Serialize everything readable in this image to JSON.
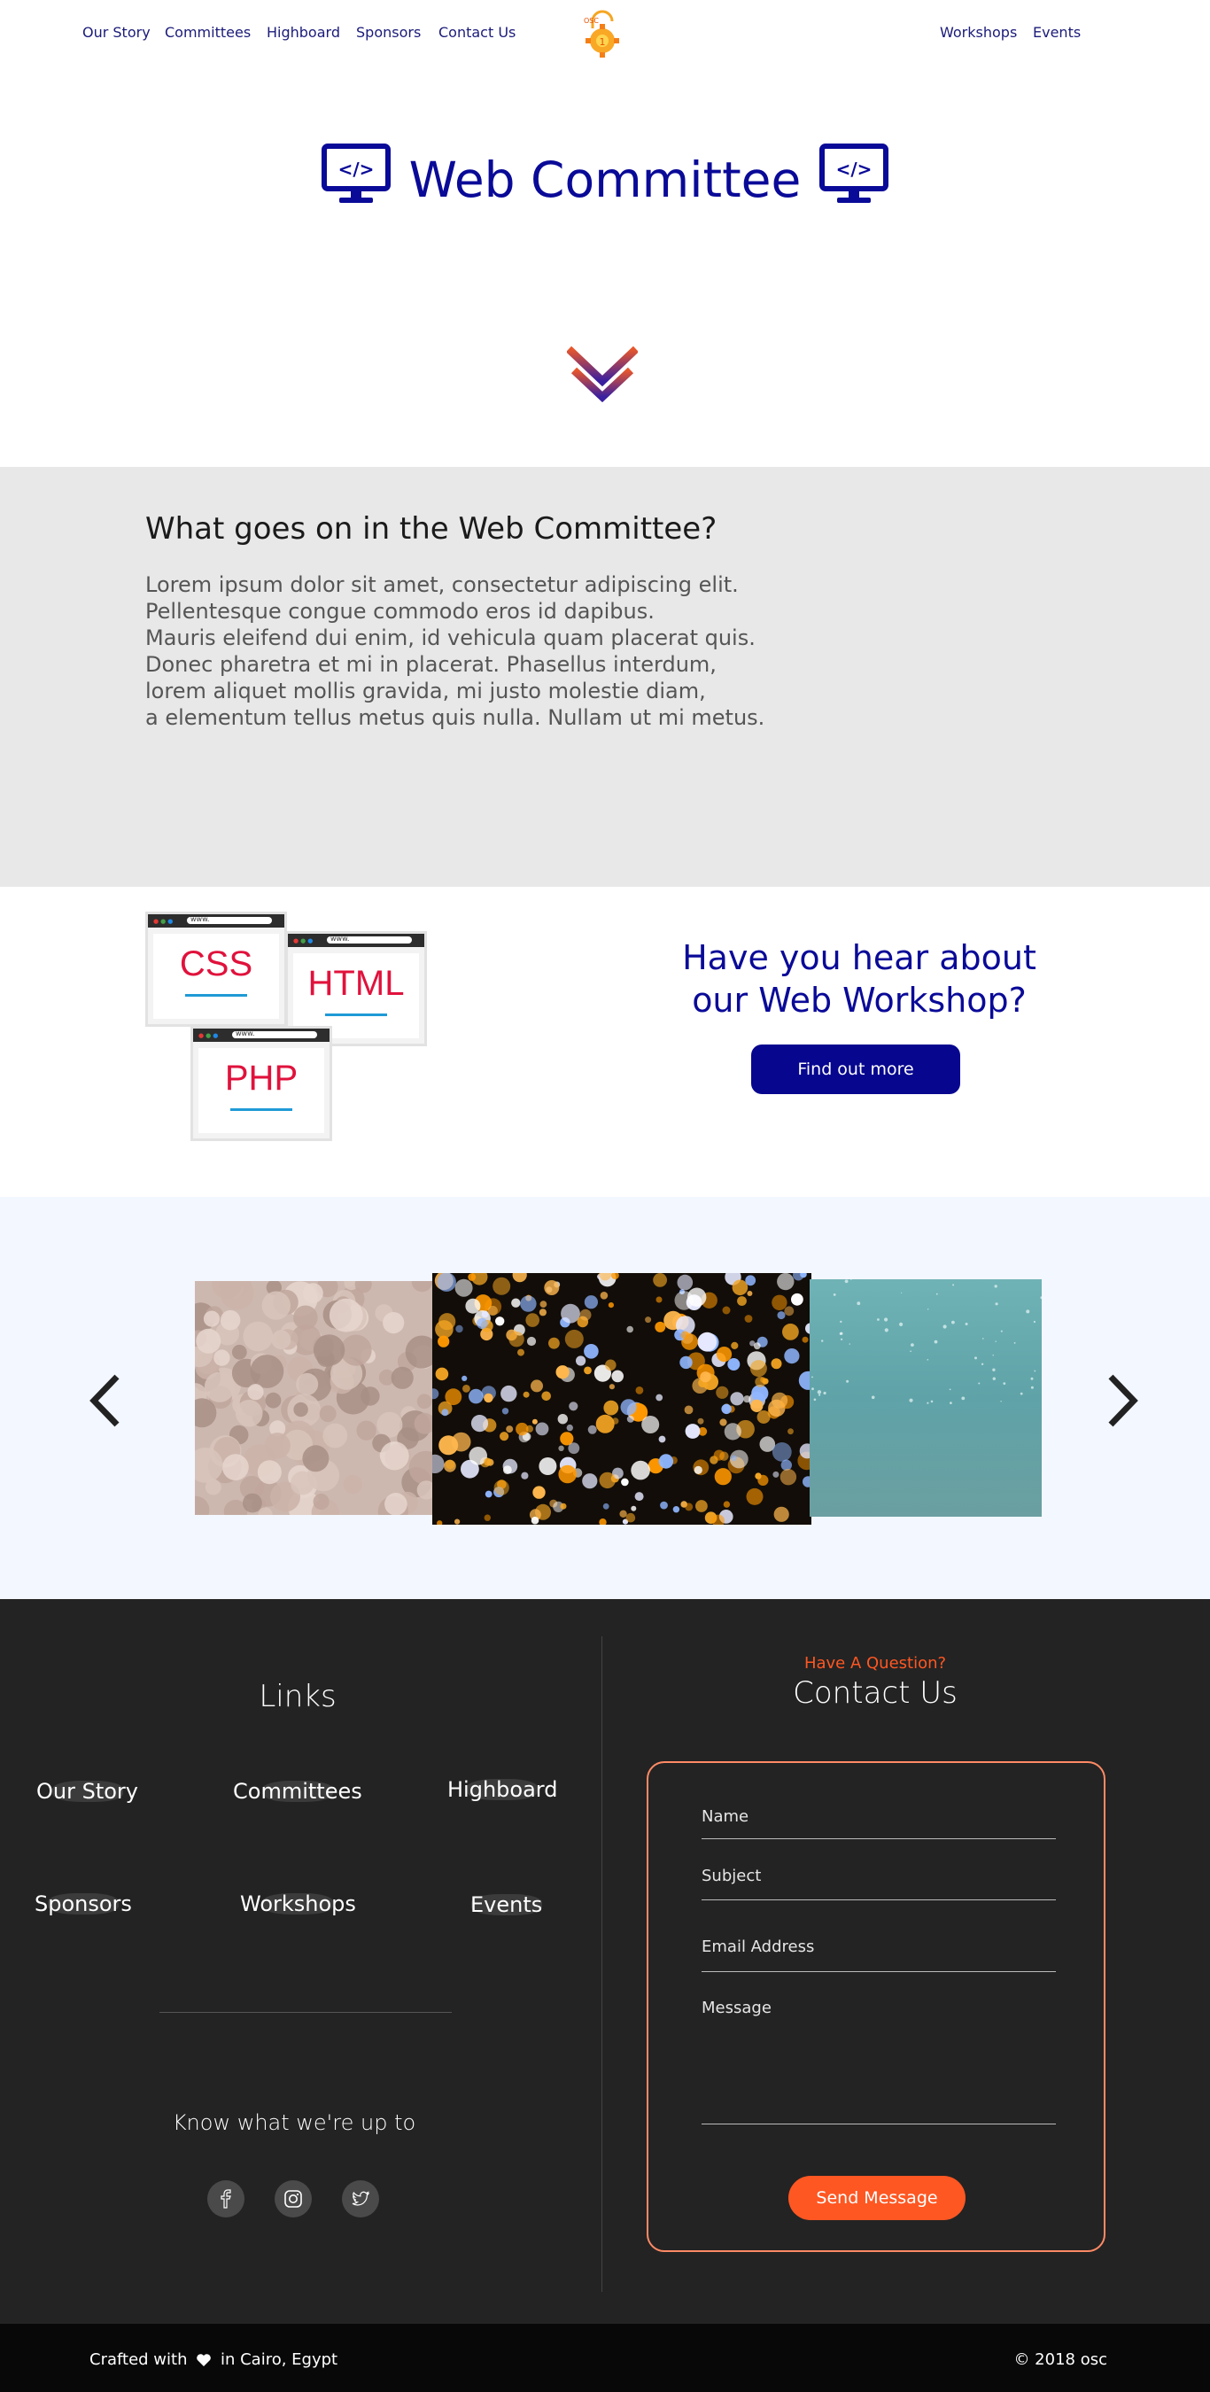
{
  "nav": {
    "left_links": [
      "Our Story",
      "Committees",
      "Highboard",
      "Sponsors",
      "Contact Us"
    ],
    "right_links": [
      "Workshops",
      "Events"
    ],
    "logo_text": "OSC"
  },
  "hero": {
    "title": "Web Committee",
    "icon": "code-monitor-icon"
  },
  "about": {
    "heading": "What goes on in the Web Committee?",
    "lines": [
      "Lorem ipsum dolor sit amet, consectetur adipiscing elit.",
      "Pellentesque congue commodo eros id dapibus.",
      "Mauris eleifend dui enim, id vehicula quam placerat quis.",
      "Donec pharetra et mi in placerat. Phasellus interdum,",
      "lorem aliquet mollis gravida, mi justo molestie diam,",
      "a elementum tellus metus quis nulla. Nullam ut mi metus."
    ]
  },
  "workshop": {
    "browser_labels": [
      "CSS",
      "HTML",
      "PHP"
    ],
    "url_text": "www.",
    "title_line1": "Have you hear about",
    "title_line2": "our Web Workshop?",
    "button_label": "Find out more"
  },
  "carousel": {
    "prev_icon": "chevron-left-icon",
    "next_icon": "chevron-right-icon"
  },
  "footer": {
    "links_title": "Links",
    "links": [
      "Our Story",
      "Committees",
      "Highboard",
      "Sponsors",
      "Workshops",
      "Events"
    ],
    "know_text": "Know what we're up to",
    "social": [
      "facebook-icon",
      "instagram-icon",
      "twitter-icon"
    ],
    "question": "Have A Question?",
    "contact_title": "Contact Us",
    "form": {
      "name_placeholder": "Name",
      "subject_placeholder": "Subject",
      "email_placeholder": "Email Address",
      "message_placeholder": "Message",
      "send_label": "Send Message"
    }
  },
  "bottom": {
    "crafted_prefix": "Crafted with",
    "crafted_suffix": "in Cairo, Egypt",
    "copyright": "© 2018 osc"
  },
  "colors": {
    "brand_blue": "#0a0a98",
    "accent_orange": "#ff5722",
    "footer_bg": "#232323"
  }
}
